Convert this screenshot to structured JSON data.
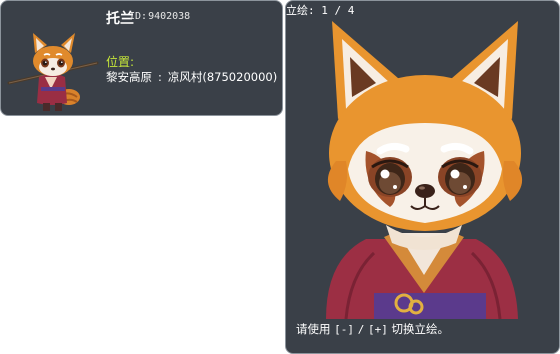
{
  "character": {
    "name": "托兰",
    "id_label": "ID:",
    "id_value": "9402038",
    "location_label": "位置:",
    "location_region": "黎安高原",
    "location_separator": ":",
    "location_town": "凉风村",
    "location_map_id": "(875020000)",
    "sprite_icon": "red-panda-warrior-sprite"
  },
  "portrait": {
    "counter_label": "立绘:",
    "counter_current": "1",
    "counter_separator": "/",
    "counter_total": "4",
    "art_icon": "red-panda-portrait",
    "hint_prefix": "请使用",
    "hint_key_prev": "[-]",
    "hint_slash": "/",
    "hint_key_next": "[+]",
    "hint_suffix": "切换立绘。"
  },
  "colors": {
    "panel_bg": "#3a4048",
    "panel_border": "#8c949c",
    "location_label": "#c6e63a",
    "text": "#ffffff"
  }
}
